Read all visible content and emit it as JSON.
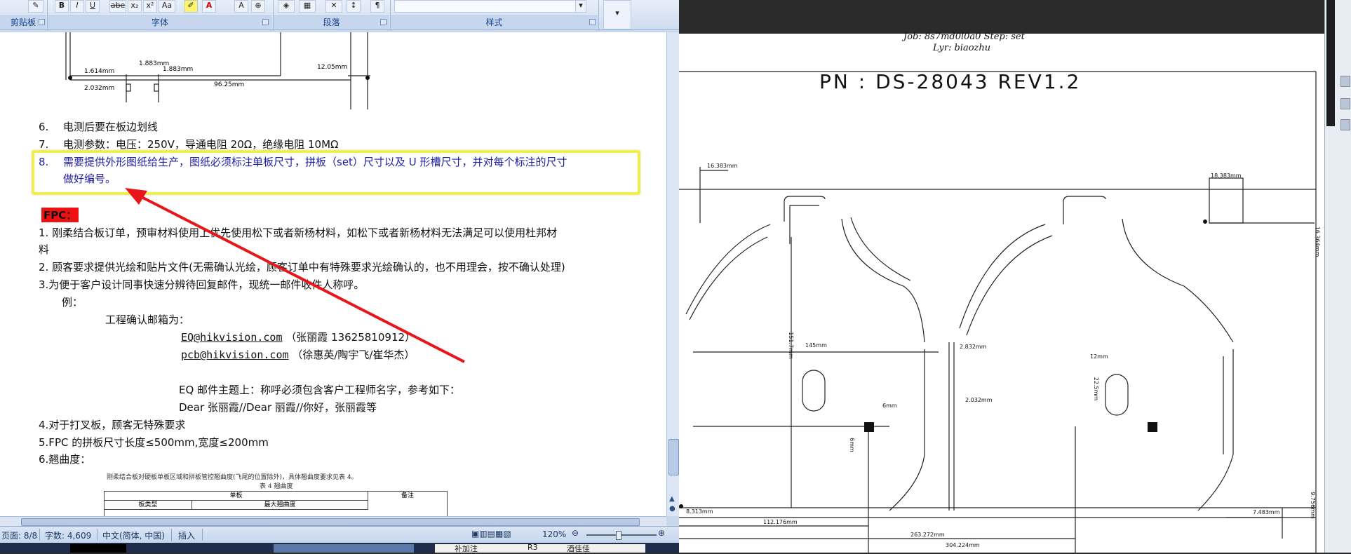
{
  "word": {
    "ribbon": {
      "groups": [
        "剪贴板",
        "字体",
        "段落",
        "样式"
      ],
      "font_buttons": [
        "B",
        "I",
        "U",
        "abe",
        "x₂",
        "x²",
        "Aa"
      ]
    },
    "doc": {
      "item6_num": "6.",
      "item6_text": "电测后要在板边划线",
      "item7_num": "7.",
      "item7_text": "电测参数：电压：250V，导通电阻 20Ω，绝缘电阻 10MΩ",
      "item8_num": "8.",
      "item8_line1": "需要提供外形图纸给生产，图纸必须标注单板尺寸，拼板（set）尺寸以及 U 形槽尺寸，并对每个标注的尺寸",
      "item8_line2": "做好编号。",
      "fpc_title": "FPC：",
      "fpc1_line1": "1.  刚柔结合板订单，预审材料使用上优先使用松下或者新杨材料，如松下或者新杨材料无法满足可以使用杜邦材",
      "fpc1_line2": "料",
      "fpc2": "2. 顾客要求提供光绘和贴片文件(无需确认光绘，顾客订单中有特殊要求光绘确认的，也不用理会，按不确认处理)",
      "fpc3": "3.为便于客户设计同事快速分辨待回复邮件，现统一邮件收件人称呼。",
      "example": "例：",
      "email_heading": "工程确认邮箱为：",
      "email1": "EQ@hikvision.com",
      "email1_note": "（张丽霞 13625810912）",
      "email2": "pcb@hikvision.com",
      "email2_note": "（徐惠英/陶宇飞/崔华杰）",
      "eq_subject": "EQ 邮件主题上：称呼必须包含客户工程师名字，参考如下：",
      "dear_line": "Dear  张丽霞//Dear  丽霞//你好，张丽霞等",
      "fpc4": "4.对于打叉板，顾客无特殊要求",
      "fpc5": "5.FPC 的拼板尺寸长度≤500mm,宽度≤200mm",
      "fpc6": "6.翘曲度：",
      "table_caption": "刚柔结合板对硬板单板区域和拼板管控翘曲度(飞尾的位置除外)，具体翘曲度要求见表 4。",
      "table_title": "表 4  翘曲度",
      "table_head_single": "单板",
      "table_head_note": "备注",
      "table_head_type": "板类型",
      "table_head_max": "最大翘曲度",
      "drawing_labels": [
        "1.614mm",
        "1.883mm",
        "1.883mm",
        "2.032mm",
        "96.25mm",
        "12.05mm"
      ]
    },
    "status": {
      "page": "页面: 8/8",
      "words": "字数: 4,609",
      "lang": "中文(简体, 中国)",
      "mode": "插入",
      "zoom": "120%"
    }
  },
  "pdf": {
    "job_line": "Job: 8s7md0l0a0  Step: set",
    "layer_line": "Lyr: biaozhu",
    "title": "PN :   DS-28043 REV1.2",
    "dims": [
      "16.383mm",
      "18.383mm",
      "16.364mm",
      "145mm",
      "151.7mm",
      "2.832mm",
      "12mm",
      "22.5mm",
      "2.032mm",
      "6mm",
      "6mm",
      "8.313mm",
      "112.176mm",
      "263.272mm",
      "304.224mm",
      "7.483mm",
      "9.756mm"
    ],
    "bottom_panel": [
      "补加注",
      "R3",
      "酒佳佳"
    ]
  },
  "colors": {
    "highlight_box": "#f4ef3c",
    "arrow": "#e8161a",
    "fpc_bg": "#ee1111",
    "item8_text": "#1f1fa8"
  }
}
